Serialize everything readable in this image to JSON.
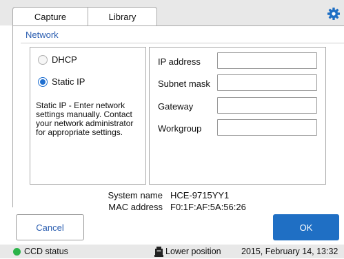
{
  "tabs": [
    {
      "label": "Capture"
    },
    {
      "label": "Library"
    }
  ],
  "icons": {
    "settings": "gear-icon",
    "lamp": "lamp-icon"
  },
  "colors": {
    "accent": "#1f6fc4",
    "status_ok": "#2cb34a",
    "section_title": "#2a5db0"
  },
  "network": {
    "title": "Network",
    "modes": [
      {
        "label": "DHCP",
        "selected": false
      },
      {
        "label": "Static IP",
        "selected": true
      }
    ],
    "description": "Static IP - Enter network settings manually. Contact your network administrator for appropriate settings.",
    "fields": [
      {
        "label": "IP address",
        "value": ""
      },
      {
        "label": "Subnet mask",
        "value": ""
      },
      {
        "label": "Gateway",
        "value": ""
      },
      {
        "label": "Workgroup",
        "value": ""
      }
    ]
  },
  "system": {
    "name_label": "System name",
    "name_value": "HCE-9715YY1",
    "mac_label": "MAC address",
    "mac_value": "F0:1F:AF:5A:56:26"
  },
  "buttons": {
    "cancel": "Cancel",
    "ok": "OK"
  },
  "status": {
    "ccd": "CCD status",
    "position": "Lower position",
    "datetime": "2015, February 14, 13:32"
  }
}
